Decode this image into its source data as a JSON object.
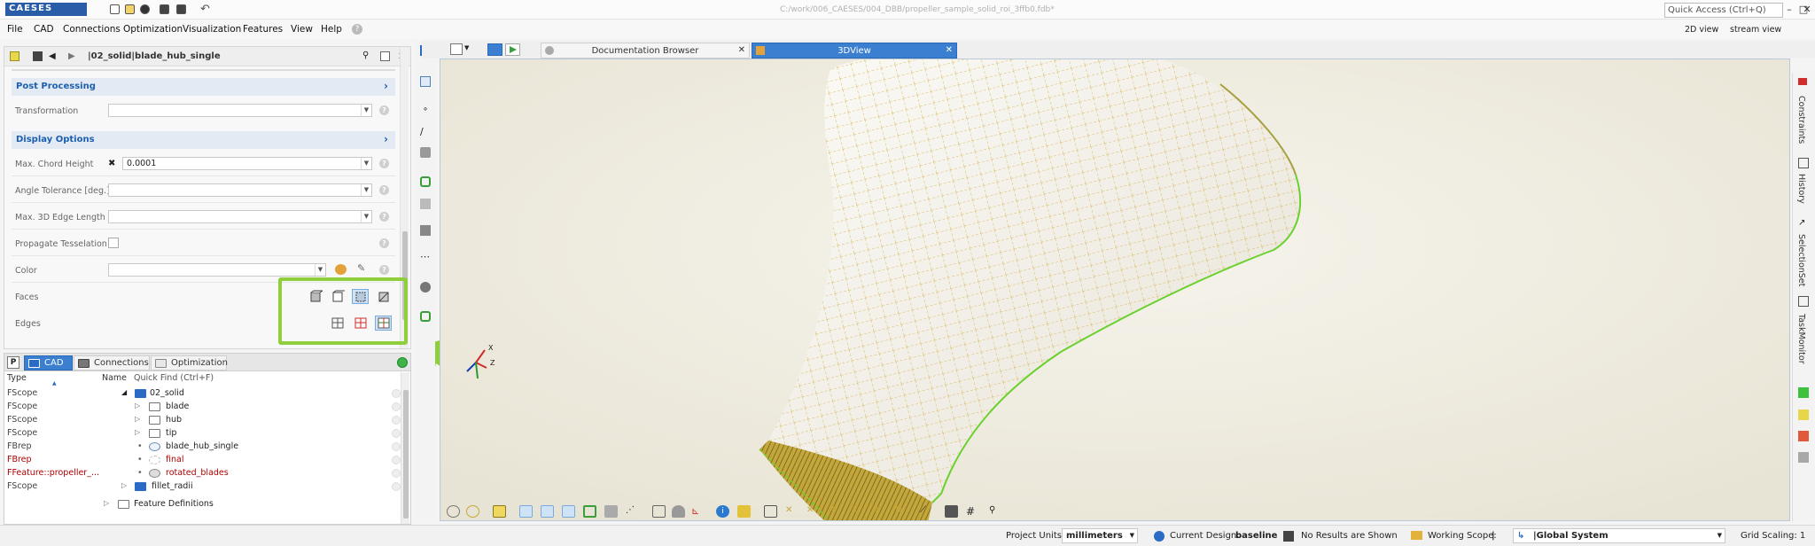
{
  "app": {
    "logo_text": "CAESES",
    "window_title": "C:/work/006_CAESES/004_DBB/propeller_sample_solid_roi_3ffb0.fdb*"
  },
  "quick_access": {
    "placeholder": "Quick Access (Ctrl+Q)"
  },
  "menu": {
    "items": [
      "File",
      "CAD",
      "Connections",
      "Optimization",
      "Visualization",
      "Features",
      "View",
      "Help"
    ],
    "right": [
      "2D view",
      "stream view"
    ]
  },
  "object_editor": {
    "breadcrumb": "|02_solid|blade_hub_single",
    "sections": {
      "post_processing": "Post Processing",
      "display_options": "Display Options"
    },
    "props": {
      "transformation": {
        "label": "Transformation",
        "value": ""
      },
      "chord_height": {
        "label": "Max. Chord Height",
        "value": "0.0001"
      },
      "angle_tol": {
        "label": "Angle Tolerance [deg.]",
        "value": ""
      },
      "edge_length": {
        "label": "Max. 3D Edge Length",
        "value": ""
      },
      "propagate": {
        "label": "Propagate Tesselation"
      },
      "color": {
        "label": "Color",
        "value": ""
      },
      "faces": {
        "label": "Faces"
      },
      "edges": {
        "label": "Edges"
      }
    }
  },
  "tree": {
    "tabs": [
      "CAD",
      "Connections",
      "Optimization"
    ],
    "p_label": "P",
    "header": {
      "type": "Type",
      "name": "Name",
      "find": "Quick Find (Ctrl+F)"
    },
    "rows": [
      {
        "type": "FScope",
        "name": "02_solid"
      },
      {
        "type": "FScope",
        "name": "blade"
      },
      {
        "type": "FScope",
        "name": "hub"
      },
      {
        "type": "FScope",
        "name": "tip"
      },
      {
        "type": "FBrep",
        "name": "blade_hub_single"
      },
      {
        "type": "FBrep",
        "name": "final"
      },
      {
        "type": "FFeature::propeller_...",
        "name": "rotated_blades"
      },
      {
        "type": "FScope",
        "name": "fillet_radii"
      },
      {
        "type": "",
        "name": "Feature Definitions"
      }
    ]
  },
  "doc_tabs": [
    "Documentation Browser",
    "3DView"
  ],
  "right_sidebar": [
    "Constraints",
    "History",
    "SelectionSet",
    "TaskMonitor"
  ],
  "status": {
    "units_label": "Project Units:",
    "units_value": "millimeters",
    "design_label": "Current Design:",
    "design_value": "baseline",
    "results": "No Results are Shown",
    "scope_label": "Working Scope:",
    "scope_value": "|",
    "system": "|Global System",
    "grid": "Grid Scaling: 1"
  },
  "colors": {
    "accent": "#3b7fd0",
    "highlight_green": "#8fce3c",
    "section_blue": "#1b5fb0",
    "mesh_line": "#d6b24a",
    "edge_green": "#6ad12e"
  },
  "axis": {
    "x": "X",
    "z": "Z"
  }
}
